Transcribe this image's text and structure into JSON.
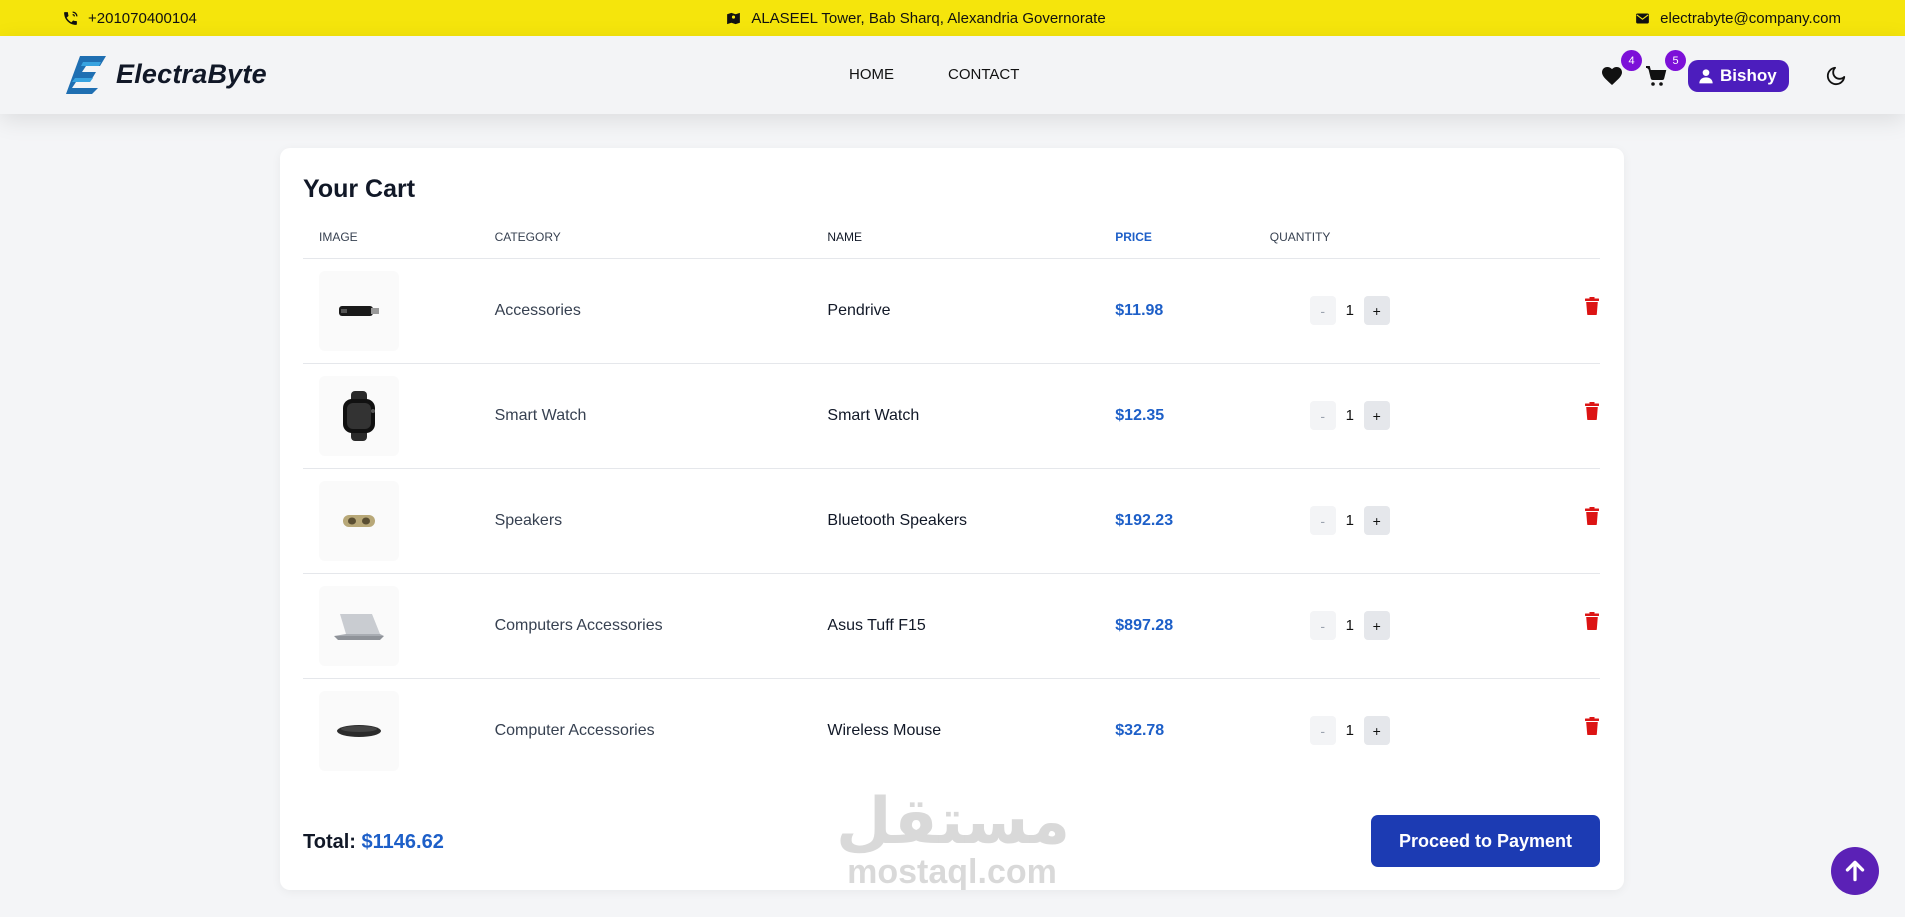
{
  "topbar": {
    "phone": "+201070400104",
    "address": "ALASEEL Tower, Bab Sharq, Alexandria Governorate",
    "email": "electrabyte@company.com",
    "phone_icon": "phone-icon",
    "address_icon": "map-icon",
    "email_icon": "envelope-icon"
  },
  "header": {
    "brand": "ElectraByte",
    "nav": {
      "home": "HOME",
      "contact": "CONTACT"
    },
    "wishlist_count": "4",
    "cart_count": "5",
    "user_name": "Bishoy"
  },
  "cart": {
    "title": "Your Cart",
    "columns": {
      "image": "IMAGE",
      "category": "CATEGORY",
      "name": "NAME",
      "price": "PRICE",
      "quantity": "QUANTITY"
    },
    "items": [
      {
        "category": "Accessories",
        "name": "Pendrive",
        "price": "$11.98",
        "qty": "1",
        "image": "pendrive"
      },
      {
        "category": "Smart Watch",
        "name": "Smart Watch",
        "price": "$12.35",
        "qty": "1",
        "image": "smartwatch"
      },
      {
        "category": "Speakers",
        "name": "Bluetooth Speakers",
        "price": "$192.23",
        "qty": "1",
        "image": "speaker"
      },
      {
        "category": "Computers Accessories",
        "name": "Asus Tuff F15",
        "price": "$897.28",
        "qty": "1",
        "image": "laptop"
      },
      {
        "category": "Computer Accessories",
        "name": "Wireless Mouse",
        "price": "$32.78",
        "qty": "1",
        "image": "mouse"
      }
    ],
    "qty_minus": "-",
    "qty_plus": "+",
    "total_label": "Total:",
    "total_value": "$1146.62",
    "proceed_label": "Proceed to Payment"
  },
  "watermark": {
    "arabic": "مستقل",
    "latin": "mostaql.com"
  },
  "colors": {
    "topbar": "#f5e50c",
    "accent": "#1d5fc8",
    "button": "#1c3bb3",
    "badge": "#7c10d8",
    "delete": "#dc1414"
  }
}
